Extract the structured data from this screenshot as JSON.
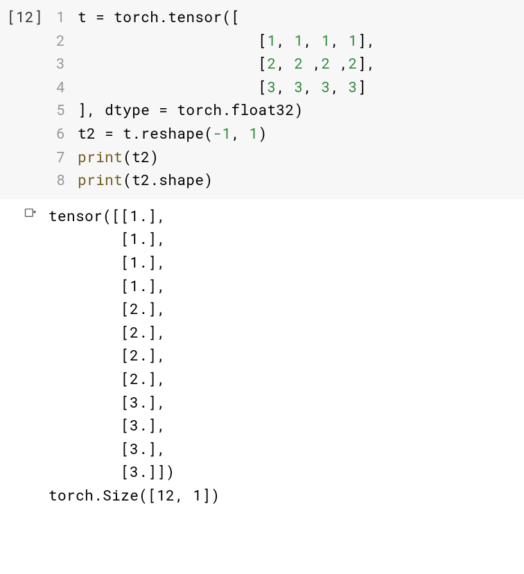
{
  "cell": {
    "prompt": "[12]",
    "lines": [
      {
        "n": "1",
        "tokens": [
          {
            "t": "t = torch.tensor(["
          }
        ]
      },
      {
        "n": "2",
        "tokens": [
          {
            "t": "                    ["
          },
          {
            "t": "1",
            "c": "tok-num"
          },
          {
            "t": ", "
          },
          {
            "t": "1",
            "c": "tok-num"
          },
          {
            "t": ", "
          },
          {
            "t": "1",
            "c": "tok-num"
          },
          {
            "t": ", "
          },
          {
            "t": "1",
            "c": "tok-num"
          },
          {
            "t": "],"
          }
        ]
      },
      {
        "n": "3",
        "tokens": [
          {
            "t": "                    ["
          },
          {
            "t": "2",
            "c": "tok-num"
          },
          {
            "t": ", "
          },
          {
            "t": "2",
            "c": "tok-num"
          },
          {
            "t": " ,"
          },
          {
            "t": "2",
            "c": "tok-num"
          },
          {
            "t": " ,"
          },
          {
            "t": "2",
            "c": "tok-num"
          },
          {
            "t": "],"
          }
        ]
      },
      {
        "n": "4",
        "tokens": [
          {
            "t": "                    ["
          },
          {
            "t": "3",
            "c": "tok-num"
          },
          {
            "t": ", "
          },
          {
            "t": "3",
            "c": "tok-num"
          },
          {
            "t": ", "
          },
          {
            "t": "3",
            "c": "tok-num"
          },
          {
            "t": ", "
          },
          {
            "t": "3",
            "c": "tok-num"
          },
          {
            "t": "]"
          }
        ]
      },
      {
        "n": "5",
        "tokens": [
          {
            "t": "], dtype = torch.float32)"
          }
        ]
      },
      {
        "n": "6",
        "tokens": [
          {
            "t": "t2 = t.reshape("
          },
          {
            "t": "-1",
            "c": "tok-num"
          },
          {
            "t": ", "
          },
          {
            "t": "1",
            "c": "tok-num"
          },
          {
            "t": ")"
          }
        ]
      },
      {
        "n": "7",
        "tokens": [
          {
            "t": "print",
            "c": "tok-builtin"
          },
          {
            "t": "(t2)"
          }
        ]
      },
      {
        "n": "8",
        "tokens": [
          {
            "t": "print",
            "c": "tok-builtin"
          },
          {
            "t": "(t2.shape)"
          }
        ]
      }
    ]
  },
  "output": {
    "text": "tensor([[1.],\n        [1.],\n        [1.],\n        [1.],\n        [2.],\n        [2.],\n        [2.],\n        [2.],\n        [3.],\n        [3.],\n        [3.],\n        [3.]])\ntorch.Size([12, 1])"
  }
}
